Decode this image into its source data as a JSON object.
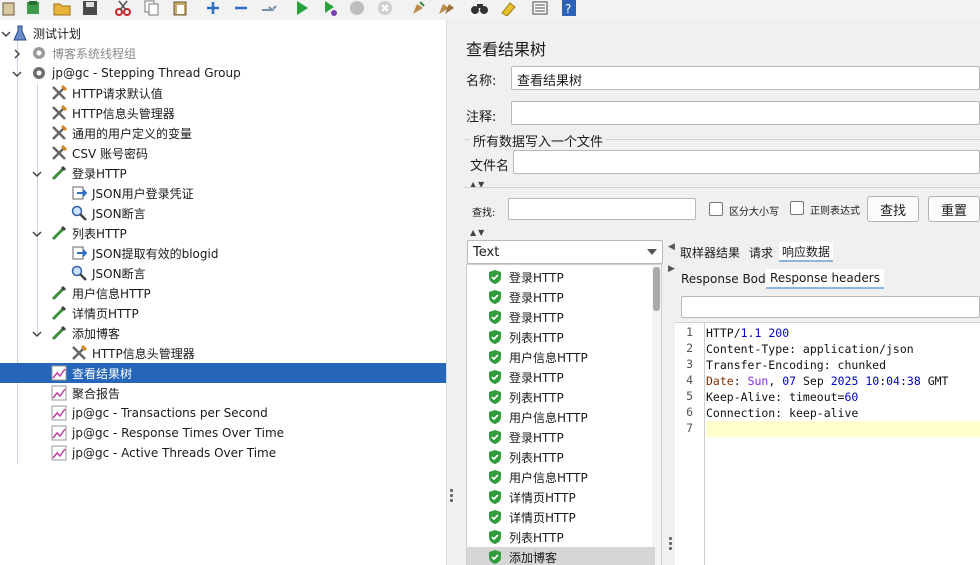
{
  "toolbar": {
    "icons": [
      "clipboard-icon",
      "template-icon",
      "open-icon",
      "save-icon",
      "cut-icon",
      "copy-icon",
      "paste-icon",
      "expand-icon",
      "collapse-icon",
      "toggle-icon",
      "start-icon",
      "start-no-pause-icon",
      "stop-icon",
      "shutdown-icon",
      "clear-icon",
      "clear-all-icon",
      "search-icon",
      "reset-search-icon",
      "function-helper-icon",
      "help-icon"
    ]
  },
  "tree": {
    "items": [
      {
        "label": "测试计划"
      },
      {
        "label": "博客系统线程组"
      },
      {
        "label": "jp@gc - Stepping Thread Group"
      },
      {
        "label": "HTTP请求默认值"
      },
      {
        "label": "HTTP信息头管理器"
      },
      {
        "label": "通用的用户定义的变量"
      },
      {
        "label": "CSV 账号密码"
      },
      {
        "label": "登录HTTP"
      },
      {
        "label": "JSON用户登录凭证"
      },
      {
        "label": "JSON断言"
      },
      {
        "label": "列表HTTP"
      },
      {
        "label": "JSON提取有效的blogid"
      },
      {
        "label": "JSON断言"
      },
      {
        "label": "用户信息HTTP"
      },
      {
        "label": "详情页HTTP"
      },
      {
        "label": "添加博客"
      },
      {
        "label": "HTTP信息头管理器"
      },
      {
        "label": "查看结果树"
      },
      {
        "label": "聚合报告"
      },
      {
        "label": "jp@gc - Transactions per Second"
      },
      {
        "label": "jp@gc - Response Times Over Time"
      },
      {
        "label": "jp@gc - Active Threads Over Time"
      }
    ]
  },
  "panel": {
    "title": "查看结果树",
    "name_label": "名称:",
    "name_value": "查看结果树",
    "comment_label": "注释:",
    "comment_value": "",
    "file_section": "所有数据写入一个文件",
    "filename_label": "文件名",
    "filename_value": "",
    "search_label": "查找:",
    "search_value": "",
    "case_label": "区分大小写",
    "regex_label": "正则表达式",
    "find_button": "查找",
    "reset_button": "重置",
    "renderer_value": "Text"
  },
  "results": [
    "登录HTTP",
    "登录HTTP",
    "登录HTTP",
    "列表HTTP",
    "用户信息HTTP",
    "登录HTTP",
    "列表HTTP",
    "用户信息HTTP",
    "登录HTTP",
    "列表HTTP",
    "用户信息HTTP",
    "详情页HTTP",
    "详情页HTTP",
    "列表HTTP",
    "添加博客"
  ],
  "tabs": [
    "取样器结果",
    "请求",
    "响应数据"
  ],
  "subtabs": [
    "Response Body",
    "Response headers"
  ],
  "editor": {
    "line_numbers": [
      "1",
      "2",
      "3",
      "4",
      "5",
      "6",
      "7"
    ]
  },
  "colors": {
    "selection": "#2566b8",
    "success": "#2e9d3a",
    "highlight_line": "#ffffcc"
  }
}
